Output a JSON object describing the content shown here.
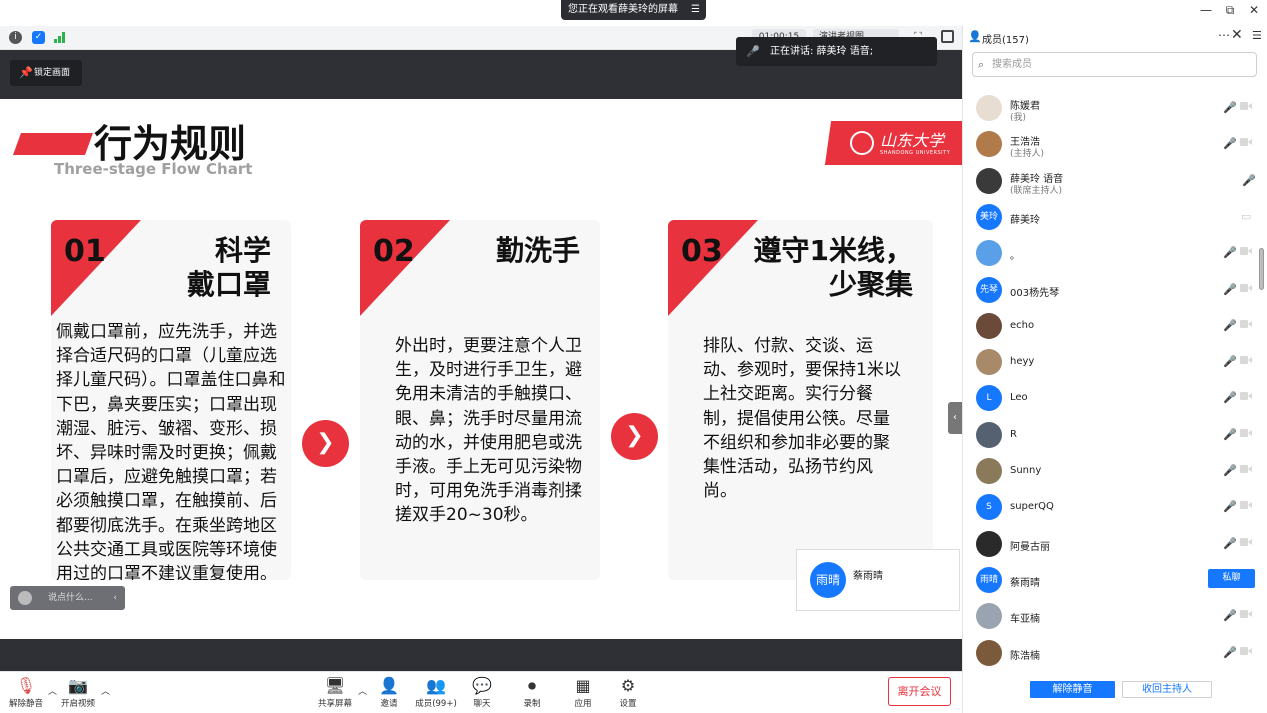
{
  "window": {
    "share_banner": "您正在观看薛美玲的屏幕",
    "share_banner_icon": "list-icon",
    "controls": [
      "—",
      "⧉",
      "✕"
    ]
  },
  "toolbar": {
    "timer": "01:00:15",
    "speaker_view": "演讲者视图",
    "fullscreen_icon": "⛶"
  },
  "stage": {
    "lock_label": "锁定画面",
    "speaking_label": "正在讲话: 薛美玲 语音;",
    "chat_placeholder": "说点什么...",
    "name_card": {
      "avatar": "雨晴",
      "name": "蔡雨晴"
    }
  },
  "slide": {
    "title": "行为规则",
    "subtitle": "Three-stage Flow Chart",
    "logo_text": "山东大学",
    "logo_sub": "SHANDONG UNIVERSITY",
    "cards": [
      {
        "num": "01",
        "heading": "科学\n戴口罩",
        "body": "佩戴口罩前，应先洗手，并选择合适尺码的口罩（儿童应选择儿童尺码）。口罩盖住口鼻和下巴，鼻夹要压实；口罩出现潮湿、脏污、皱褶、变形、损坏、异味时需及时更换；佩戴口罩后，应避免触摸口罩；若必须触摸口罩，在触摸前、后都要彻底洗手。在乘坐跨地区公共交通工具或医院等环境使用过的口罩不建议重复使用。"
      },
      {
        "num": "02",
        "heading": "勤洗手",
        "body": "外出时，更要注意个人卫生，及时进行手卫生，避免用未清洁的手触摸口、眼、鼻；洗手时尽量用流动的水，并使用肥皂或洗手液。手上无可见污染物时，可用免洗手消毒剂揉搓双手20~30秒。"
      },
      {
        "num": "03",
        "heading": "遵守1米线，\n少聚集",
        "body": "排队、付款、交谈、运动、参观时，要保持1米以上社交距离。实行分餐制，提倡使用公筷。尽量不组织和参加非必要的聚集性活动，弘扬节约风尚。"
      }
    ]
  },
  "bottom": {
    "unmute": "解除静音",
    "start_video": "开启视频",
    "share": "共享屏幕",
    "invite": "邀请",
    "members": "成员(99+)",
    "chat": "聊天",
    "record": "录制",
    "apps": "应用",
    "settings": "设置",
    "leave": "离开会议"
  },
  "panel": {
    "title": "成员(157)",
    "search_placeholder": "搜索成员",
    "private_chat": "私聊",
    "unmute_all": "解除静音",
    "reclaim_host": "收回主持人",
    "members": [
      {
        "name": "陈媛君",
        "role": "(我)",
        "avatar": "",
        "color": "#e8ddd2",
        "mic": "muted"
      },
      {
        "name": "王浩浩",
        "role": "(主持人)",
        "avatar": "",
        "color": "#b07a4a",
        "mic": "muted"
      },
      {
        "name": "薛美玲 语音",
        "role": "(联席主持人)",
        "avatar": "",
        "color": "#3a3a3a",
        "mic": "active"
      },
      {
        "name": "薛美玲",
        "role": "",
        "avatar": "美玲",
        "color": "#1677ff",
        "mic": "screen"
      },
      {
        "name": "。",
        "role": "",
        "avatar": "",
        "color": "#5aa0e8",
        "mic": "muted"
      },
      {
        "name": "003杨先琴",
        "role": "",
        "avatar": "先琴",
        "color": "#1677ff",
        "mic": "muted"
      },
      {
        "name": "echo",
        "role": "",
        "avatar": "",
        "color": "#6b4a3a",
        "mic": "muted"
      },
      {
        "name": "heyy",
        "role": "",
        "avatar": "",
        "color": "#a88a6a",
        "mic": "muted"
      },
      {
        "name": "Leo",
        "role": "",
        "avatar": "L",
        "color": "#1677ff",
        "mic": "muted"
      },
      {
        "name": "R",
        "role": "",
        "avatar": "",
        "color": "#556070",
        "mic": "muted"
      },
      {
        "name": "Sunny",
        "role": "",
        "avatar": "",
        "color": "#8a7a5a",
        "mic": "muted"
      },
      {
        "name": "superQQ",
        "role": "",
        "avatar": "S",
        "color": "#1677ff",
        "mic": "muted"
      },
      {
        "name": "阿曼古丽",
        "role": "",
        "avatar": "",
        "color": "#2a2a2a",
        "mic": "muted"
      },
      {
        "name": "蔡雨晴",
        "role": "",
        "avatar": "雨晴",
        "color": "#1677ff",
        "mic": "private"
      },
      {
        "name": "车亚楠",
        "role": "",
        "avatar": "",
        "color": "#9aa4b0",
        "mic": "muted"
      },
      {
        "name": "陈浩楠",
        "role": "",
        "avatar": "",
        "color": "#7a5a3a",
        "mic": "muted"
      }
    ]
  }
}
